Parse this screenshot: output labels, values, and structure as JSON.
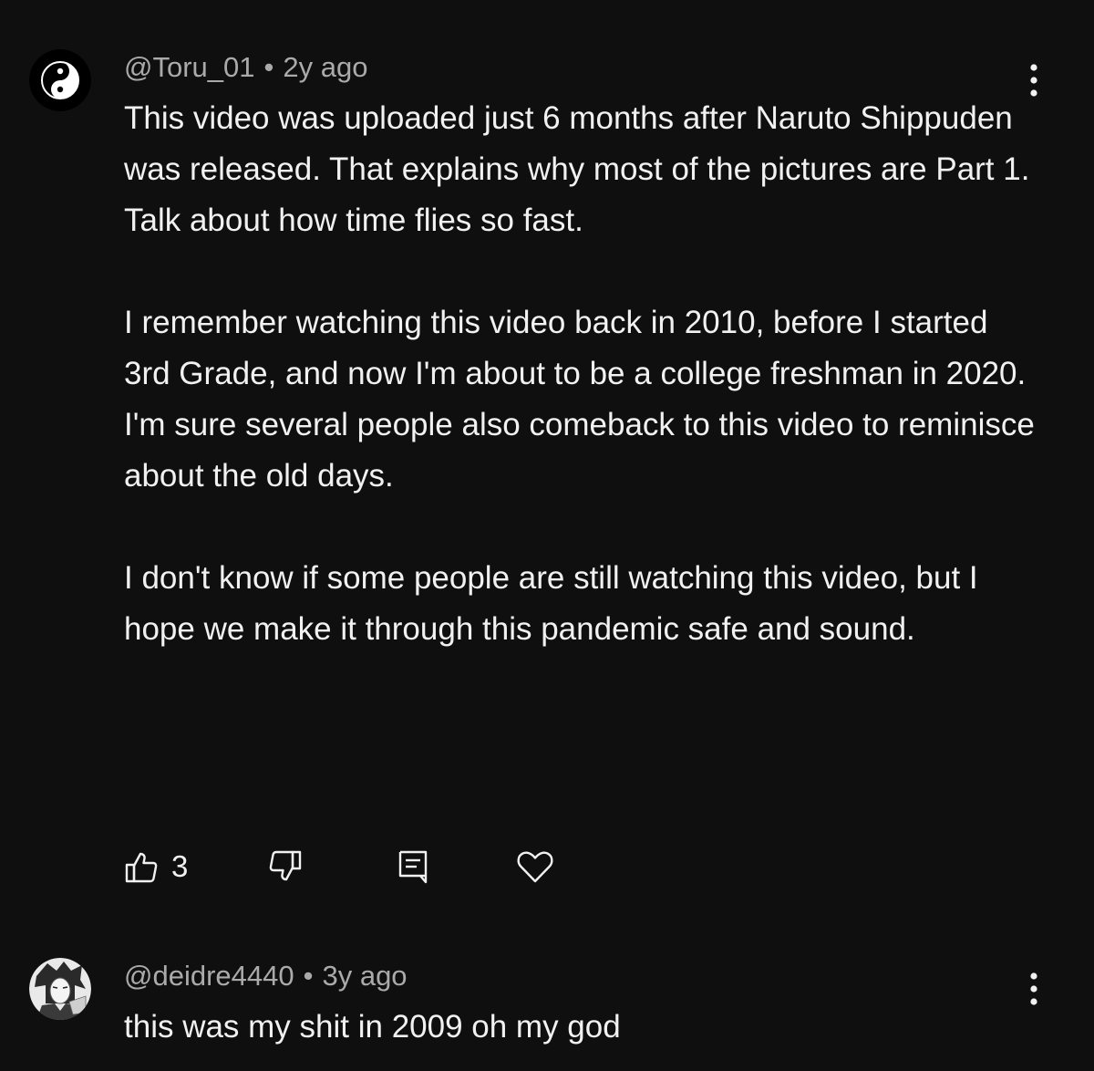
{
  "comments": [
    {
      "author": "@Toru_01",
      "separator": "•",
      "time": "2y ago",
      "paragraphs": [
        "This video was uploaded just 6 months after Naruto Shippuden was released. That explains why most of the pictures are Part 1. Talk about how time flies so fast.",
        "",
        "I remember watching this video back in 2010, before I started 3rd Grade, and now I'm about to be a college freshman in 2020.",
        "I'm sure several people also comeback to this video to reminisce about the old days.",
        "",
        "I don't know if some people are still watching this video, but I hope we make it through this pandemic safe and sound."
      ],
      "likes": "3",
      "avatar_icon": "yin-yang-icon"
    },
    {
      "author": "@deidre4440",
      "separator": "•",
      "time": "3y ago",
      "paragraphs": [
        "this was my shit in 2009 oh my god"
      ],
      "avatar_icon": "anime-character-avatar"
    }
  ],
  "icons": {
    "like": "thumbs-up-icon",
    "dislike": "thumbs-down-icon",
    "reply": "reply-icon",
    "heart": "heart-icon",
    "menu": "kebab-menu-icon"
  },
  "colors": {
    "background": "#0f0f0f",
    "text": "#f1f1f1",
    "secondary": "#aaaaaa"
  }
}
